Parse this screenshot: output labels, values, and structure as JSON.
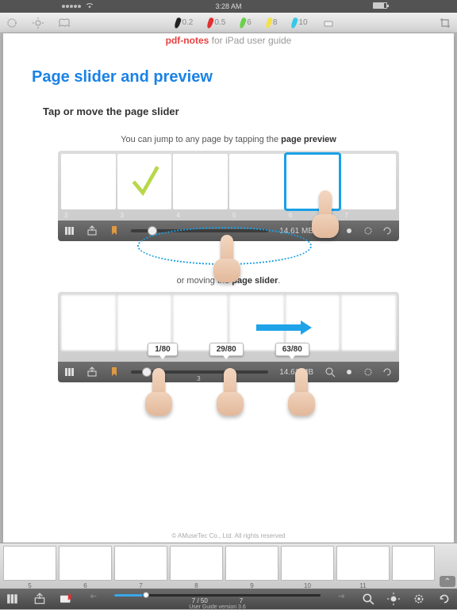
{
  "status": {
    "time": "3:28 AM"
  },
  "toolbar": {
    "pen1": {
      "size": "0.2",
      "color": "#222222"
    },
    "pen2": {
      "size": "0.5",
      "color": "#e03030"
    },
    "hl1": {
      "size": "6",
      "color": "#6cd04a"
    },
    "hl2": {
      "size": "8",
      "color": "#f4e14b"
    },
    "hl3": {
      "size": "10",
      "color": "#35c9e8"
    }
  },
  "doc_header": {
    "brand": "pdf-notes",
    "rest": " for iPad user guide"
  },
  "title": "Page slider and preview",
  "subtitle": "Tap or move the page slider",
  "caption1_pre": "You can jump to any page by tapping the ",
  "caption1_b": "page preview",
  "caption2_pre": "or moving the ",
  "caption2_b": "page slider",
  "caption2_post": ".",
  "illus1": {
    "thumb_nums": [
      "2",
      "3",
      "4",
      "5",
      "6",
      "7"
    ],
    "selected_index": 4,
    "bar": {
      "filesize": "14.61 MB",
      "knob_pct": 12
    }
  },
  "illus2": {
    "thumb_nums": [
      "",
      "",
      "",
      "",
      "",
      ""
    ],
    "bar": {
      "filesize": "14.61 MB",
      "page_mid": "3",
      "knob_pct": 8
    },
    "markers": [
      "1/80",
      "29/80",
      "63/80"
    ]
  },
  "strip": {
    "pages": [
      "5",
      "6",
      "7",
      "8",
      "9",
      "10",
      "11"
    ]
  },
  "bottom": {
    "page_counter": "7 / 50",
    "version": "User Guide version 3.6",
    "knob_pct": 14,
    "total_label": "7"
  },
  "copyright": "© AMuseTec Co., Ltd. All rights reserved"
}
